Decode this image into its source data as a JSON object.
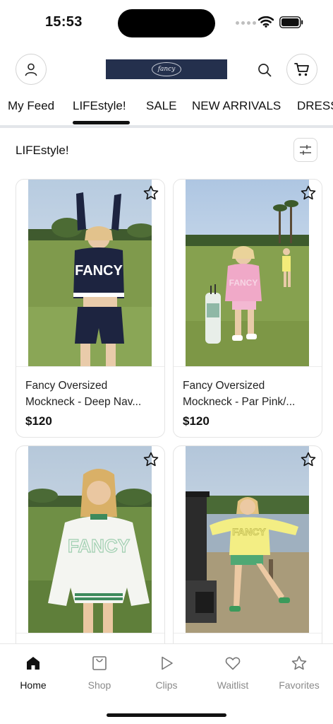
{
  "status_bar": {
    "time": "15:53"
  },
  "header": {
    "logo_text": "fancy"
  },
  "tabs": [
    {
      "label": "My Feed"
    },
    {
      "label": "LIFEstyle!"
    },
    {
      "label": "SALE"
    },
    {
      "label": "NEW ARRIVALS"
    },
    {
      "label": "DRESSES"
    }
  ],
  "active_tab_index": 1,
  "section": {
    "title": "LIFEstyle!"
  },
  "products": [
    {
      "name_line1": "Fancy Oversized",
      "name_line2": "Mockneck - Deep Nav...",
      "price": "$120"
    },
    {
      "name_line1": "Fancy Oversized",
      "name_line2": "Mockneck - Par Pink/...",
      "price": "$120"
    },
    {
      "name_line1": "",
      "name_line2": "",
      "price": ""
    },
    {
      "name_line1": "",
      "name_line2": "",
      "price": ""
    }
  ],
  "bottom_nav": [
    {
      "label": "Home",
      "icon": "home-icon",
      "active": true
    },
    {
      "label": "Shop",
      "icon": "shopping-bag-icon",
      "active": false
    },
    {
      "label": "Clips",
      "icon": "play-icon",
      "active": false
    },
    {
      "label": "Waitlist",
      "icon": "heart-icon",
      "active": false
    },
    {
      "label": "Favorites",
      "icon": "star-icon",
      "active": false
    }
  ],
  "colors": {
    "accent": "#111111",
    "logo_bg": "#24304d",
    "inactive": "#8a8a8a"
  }
}
